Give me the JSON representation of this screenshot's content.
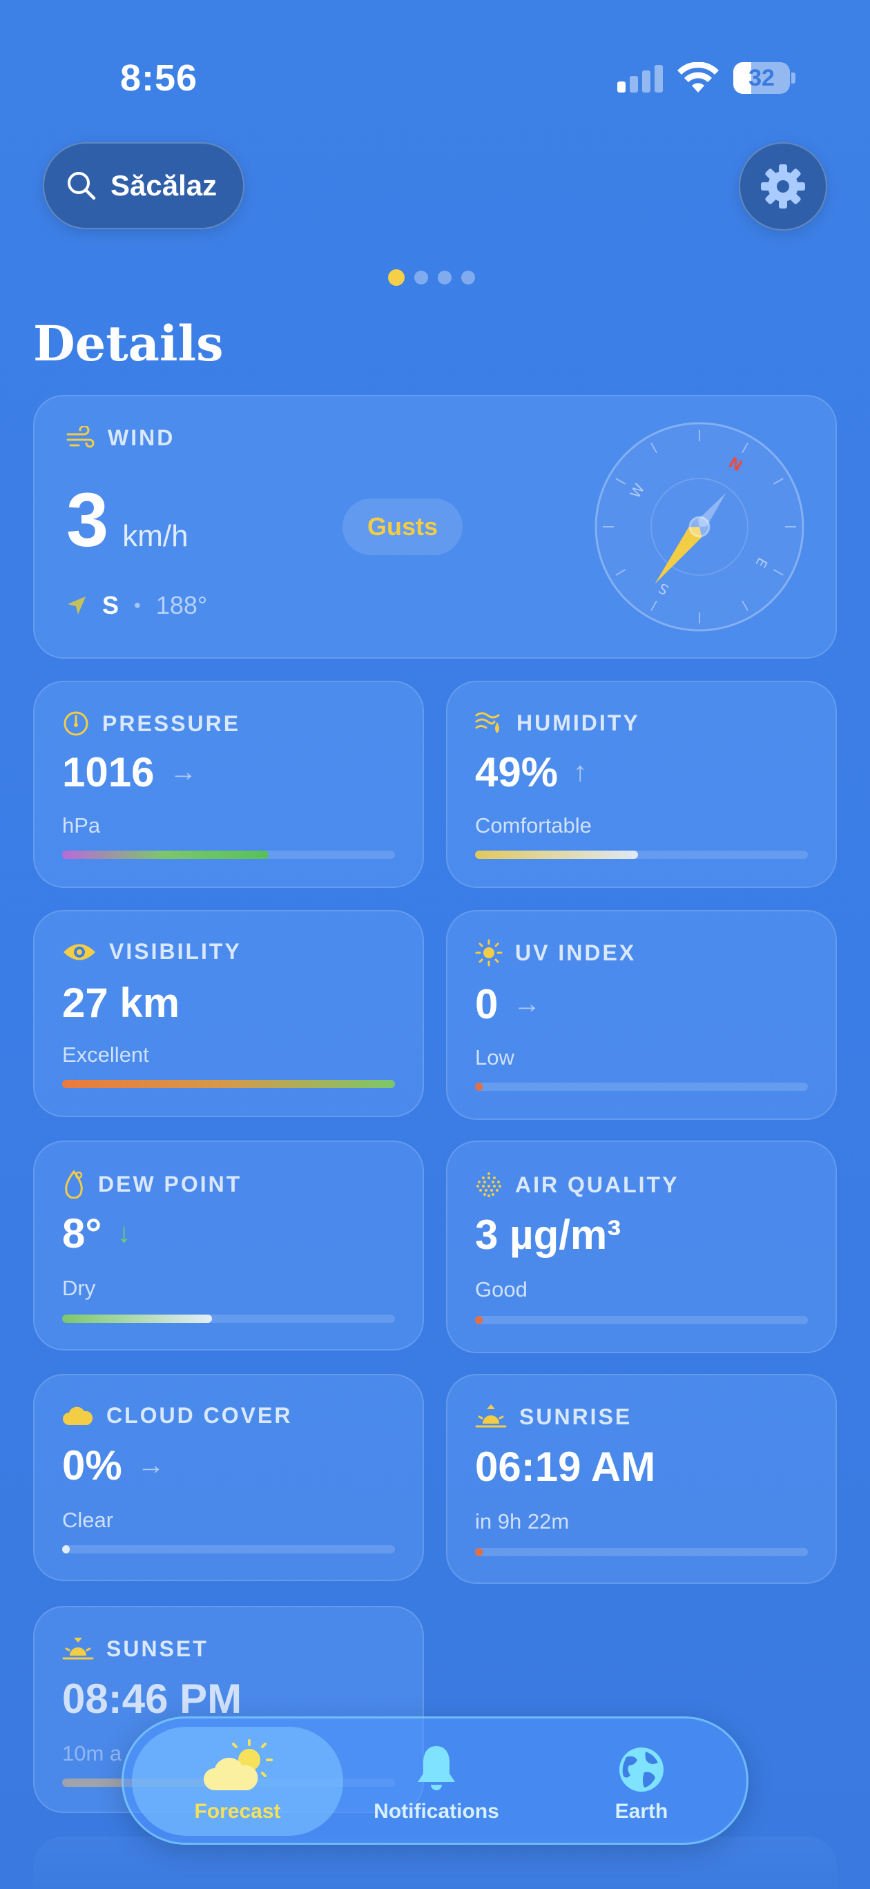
{
  "status_bar": {
    "time": "8:56",
    "battery": "32",
    "battery_level": 0.32
  },
  "search": {
    "location": "Săcălaz"
  },
  "page_indicator": {
    "count": 4,
    "active_index": 0
  },
  "section_title": "Details",
  "wind": {
    "label": "WIND",
    "speed": "3",
    "unit": "km/h",
    "gusts_label": "Gusts",
    "direction": "S",
    "degrees": "188°",
    "compass_labels": {
      "n": "N",
      "e": "E",
      "s": "S",
      "w": "W"
    },
    "heading_degrees": 188
  },
  "pressure": {
    "label": "PRESSURE",
    "value": "1016",
    "unit": "hPa",
    "level": 0.62
  },
  "humidity": {
    "label": "HUMIDITY",
    "value": "49%",
    "description": "Comfortable",
    "level": 0.49
  },
  "visibility": {
    "label": "VISIBILITY",
    "value": "27 km",
    "description": "Excellent",
    "level": 1.0
  },
  "uv_index": {
    "label": "UV INDEX",
    "value": "0",
    "description": "Low",
    "level": 0.0
  },
  "dew_point": {
    "label": "DEW POINT",
    "value": "8°",
    "description": "Dry",
    "level": 0.45
  },
  "air_quality": {
    "label": "AIR QUALITY",
    "value": "3 µg/m³",
    "description": "Good",
    "level": 0.01
  },
  "cloud_cover": {
    "label": "CLOUD COVER",
    "value": "0%",
    "description": "Clear",
    "level": 0.0
  },
  "sunrise": {
    "label": "SUNRISE",
    "value": "06:19 AM",
    "description": "in 9h 22m",
    "level": 0.01
  },
  "sunset": {
    "label": "SUNSET",
    "value": "08:46 PM",
    "description": "10m a",
    "level": 0.5
  },
  "tabbar": {
    "forecast": "Forecast",
    "notifications": "Notifications",
    "earth": "Earth"
  },
  "colors": {
    "accent_yellow": "#f5cf47",
    "background": "#3b7de6"
  }
}
